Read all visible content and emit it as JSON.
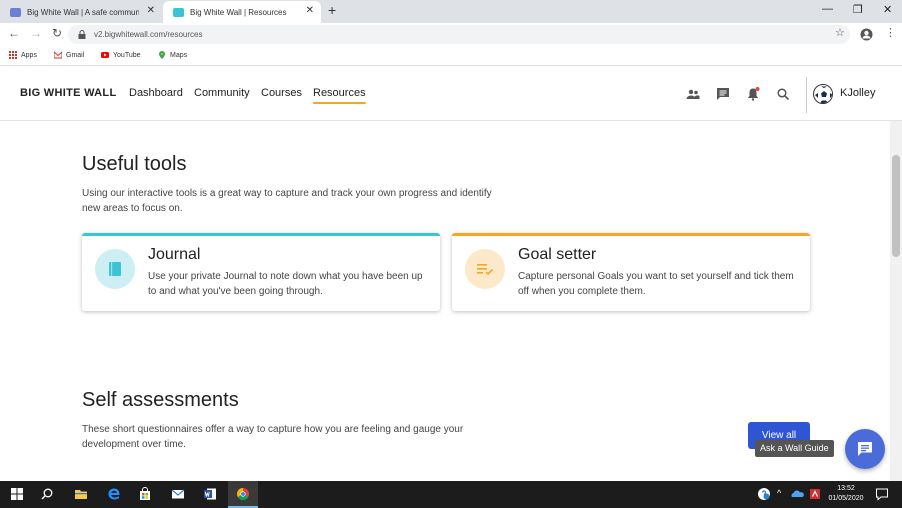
{
  "browser": {
    "tabs": [
      {
        "title": "Big White Wall | A safe community"
      },
      {
        "title": "Big White Wall | Resources"
      }
    ],
    "url": "v2.bigwhitewall.com/resources",
    "bookmarks": [
      {
        "label": "Apps",
        "icon": "apps-grid-icon"
      },
      {
        "label": "Gmail",
        "icon": "gmail-icon"
      },
      {
        "label": "YouTube",
        "icon": "youtube-icon"
      },
      {
        "label": "Maps",
        "icon": "maps-icon"
      }
    ]
  },
  "site": {
    "logo": "BIG WHITE WALL",
    "nav": [
      {
        "label": "Dashboard"
      },
      {
        "label": "Community"
      },
      {
        "label": "Courses"
      },
      {
        "label": "Resources"
      }
    ],
    "username": "KJolley"
  },
  "tools": {
    "heading": "Useful tools",
    "description": "Using our interactive tools is a great way to capture and track your own progress and identify new areas to focus on.",
    "cards": [
      {
        "title": "Journal",
        "text": "Use your private Journal to note down what you have been up to and what you've been going through.",
        "accent": "#3bc3d6"
      },
      {
        "title": "Goal setter",
        "text": "Capture personal Goals you want to set yourself and tick them off when you complete them.",
        "accent": "#f5a623"
      }
    ]
  },
  "assessments": {
    "heading": "Self assessments",
    "description": "These short questionnaires offer a way to capture how you are feeling and gauge your development over time.",
    "view_all": "View all"
  },
  "chat": {
    "tooltip": "Ask a Wall Guide"
  },
  "taskbar": {
    "time": "13:52",
    "date": "01/05/2020"
  }
}
